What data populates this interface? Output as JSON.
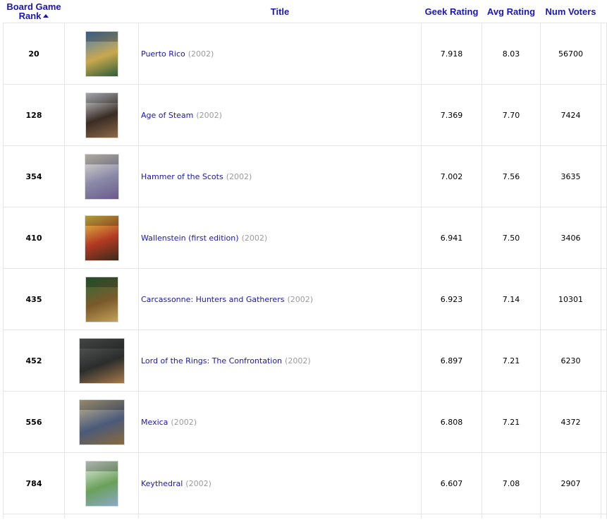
{
  "header": {
    "rank_line1": "Board Game",
    "rank_line2": "Rank",
    "title": "Title",
    "geek_rating": "Geek Rating",
    "avg_rating": "Avg Rating",
    "num_voters": "Num Voters"
  },
  "rows": [
    {
      "rank": "20",
      "title": "Puerto Rico",
      "year": "(2002)",
      "geek_rating": "7.918",
      "avg_rating": "8.03",
      "num_voters": "56700",
      "cover": {
        "icon": "puerto-rico-cover-image",
        "colors": [
          "#4a7fb8",
          "#c9a84e",
          "#2f5d3a"
        ]
      }
    },
    {
      "rank": "128",
      "title": "Age of Steam",
      "year": "(2002)",
      "geek_rating": "7.369",
      "avg_rating": "7.70",
      "num_voters": "7424",
      "cover": {
        "icon": "age-of-steam-cover-image",
        "colors": [
          "#d8dde4",
          "#3a2c24",
          "#8d6b4a"
        ]
      }
    },
    {
      "rank": "354",
      "title": "Hammer of the Scots",
      "year": "(2002)",
      "geek_rating": "7.002",
      "avg_rating": "7.56",
      "num_voters": "3635",
      "cover": {
        "icon": "hammer-of-the-scots-cover-image",
        "colors": [
          "#e8e2d4",
          "#8a8aa8",
          "#6b5a8c"
        ]
      }
    },
    {
      "rank": "410",
      "title": "Wallenstein (first edition)",
      "year": "(2002)",
      "geek_rating": "6.941",
      "avg_rating": "7.50",
      "num_voters": "3406",
      "cover": {
        "icon": "wallenstein-cover-image",
        "colors": [
          "#e8d24a",
          "#b33a22",
          "#3b2a1c"
        ]
      }
    },
    {
      "rank": "435",
      "title": "Carcassonne: Hunters and Gatherers",
      "year": "(2002)",
      "geek_rating": "6.923",
      "avg_rating": "7.14",
      "num_voters": "10301",
      "cover": {
        "icon": "carcassonne-hunters-gatherers-cover-image",
        "colors": [
          "#2f6b3a",
          "#7a5a2a",
          "#c4a35a"
        ]
      }
    },
    {
      "rank": "452",
      "title": "Lord of the Rings: The Confrontation",
      "year": "(2002)",
      "geek_rating": "6.897",
      "avg_rating": "7.21",
      "num_voters": "6230",
      "cover": {
        "icon": "lotr-confrontation-cover-image",
        "colors": [
          "#5b5e5c",
          "#2a2d2c",
          "#a87a4a"
        ]
      }
    },
    {
      "rank": "556",
      "title": "Mexica",
      "year": "(2002)",
      "geek_rating": "6.808",
      "avg_rating": "7.21",
      "num_voters": "4372",
      "cover": {
        "icon": "mexica-cover-image",
        "colors": [
          "#c8b890",
          "#4a5a7a",
          "#8a6a3a"
        ]
      }
    },
    {
      "rank": "784",
      "title": "Keythedral",
      "year": "(2002)",
      "geek_rating": "6.607",
      "avg_rating": "7.08",
      "num_voters": "2907",
      "cover": {
        "icon": "keythedral-cover-image",
        "colors": [
          "#e8efe8",
          "#6aa05a",
          "#8aa8c8"
        ]
      }
    }
  ]
}
